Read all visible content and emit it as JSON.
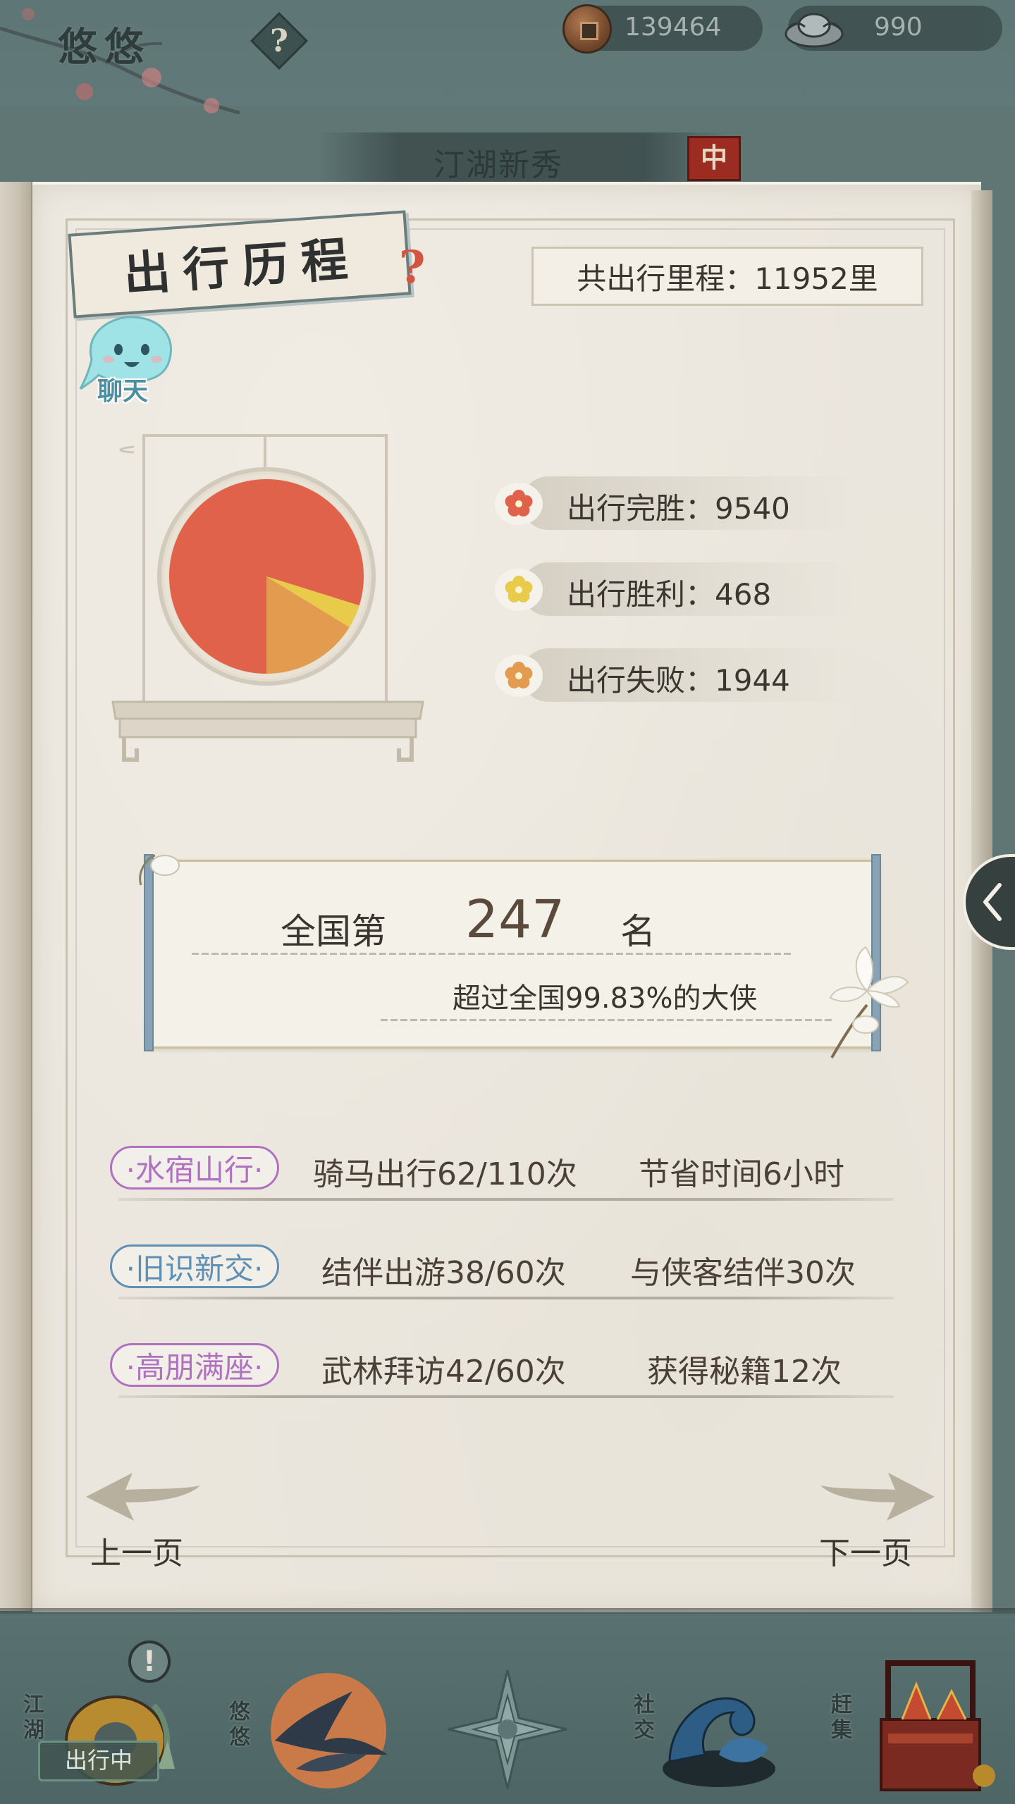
{
  "header": {
    "player_name": "悠悠",
    "help_symbol": "?",
    "copper_coins": "139464",
    "silver_ingots": "990",
    "rank_title": "汀湖新秀",
    "rank_seal": "中"
  },
  "travel": {
    "section_title": "出行历程",
    "section_help": "?",
    "total_distance": "共出行里程：11952里",
    "chat_label": "聊天",
    "legend": [
      {
        "label": "出行完胜：9540",
        "color": "#e0624b"
      },
      {
        "label": "出行胜利：468",
        "color": "#e8cb4a"
      },
      {
        "label": "出行失败：1944",
        "color": "#e39b50"
      }
    ]
  },
  "chart_data": {
    "type": "pie",
    "categories": [
      "出行完胜",
      "出行胜利",
      "出行失败"
    ],
    "values": [
      9540,
      468,
      1944
    ],
    "colors": [
      "#e0624b",
      "#e8cb4a",
      "#e39b50"
    ]
  },
  "ranking": {
    "prefix": "全国第",
    "rank": "247",
    "suffix": "名",
    "exceed_text": "超过全国99.83%的大侠"
  },
  "achievements": [
    {
      "badge": "·水宿山行·",
      "stat1": "骑马出行62/110次",
      "stat2": "节省时间6小时",
      "color": "#b072c0"
    },
    {
      "badge": "·旧识新交·",
      "stat1": "结伴出游38/60次",
      "stat2": "与侠客结伴30次",
      "color": "#5e8fb5"
    },
    {
      "badge": "·高朋满座·",
      "stat1": "武林拜访42/60次",
      "stat2": "获得秘籍12次",
      "color": "#b072c0"
    }
  ],
  "navigation": {
    "prev_label": "上一页",
    "next_label": "下一页"
  },
  "bottom_nav": {
    "items": [
      {
        "label": "江湖",
        "icon": "jianghu-gourd-icon"
      },
      {
        "label": "悠悠",
        "icon": "swallow-moon-icon"
      },
      {
        "label": "",
        "icon": "compass-star-icon"
      },
      {
        "label": "社交",
        "icon": "wave-bowl-icon"
      },
      {
        "label": "赶集",
        "icon": "market-basket-icon"
      }
    ],
    "status_chip": "出行中",
    "alert": "!"
  }
}
